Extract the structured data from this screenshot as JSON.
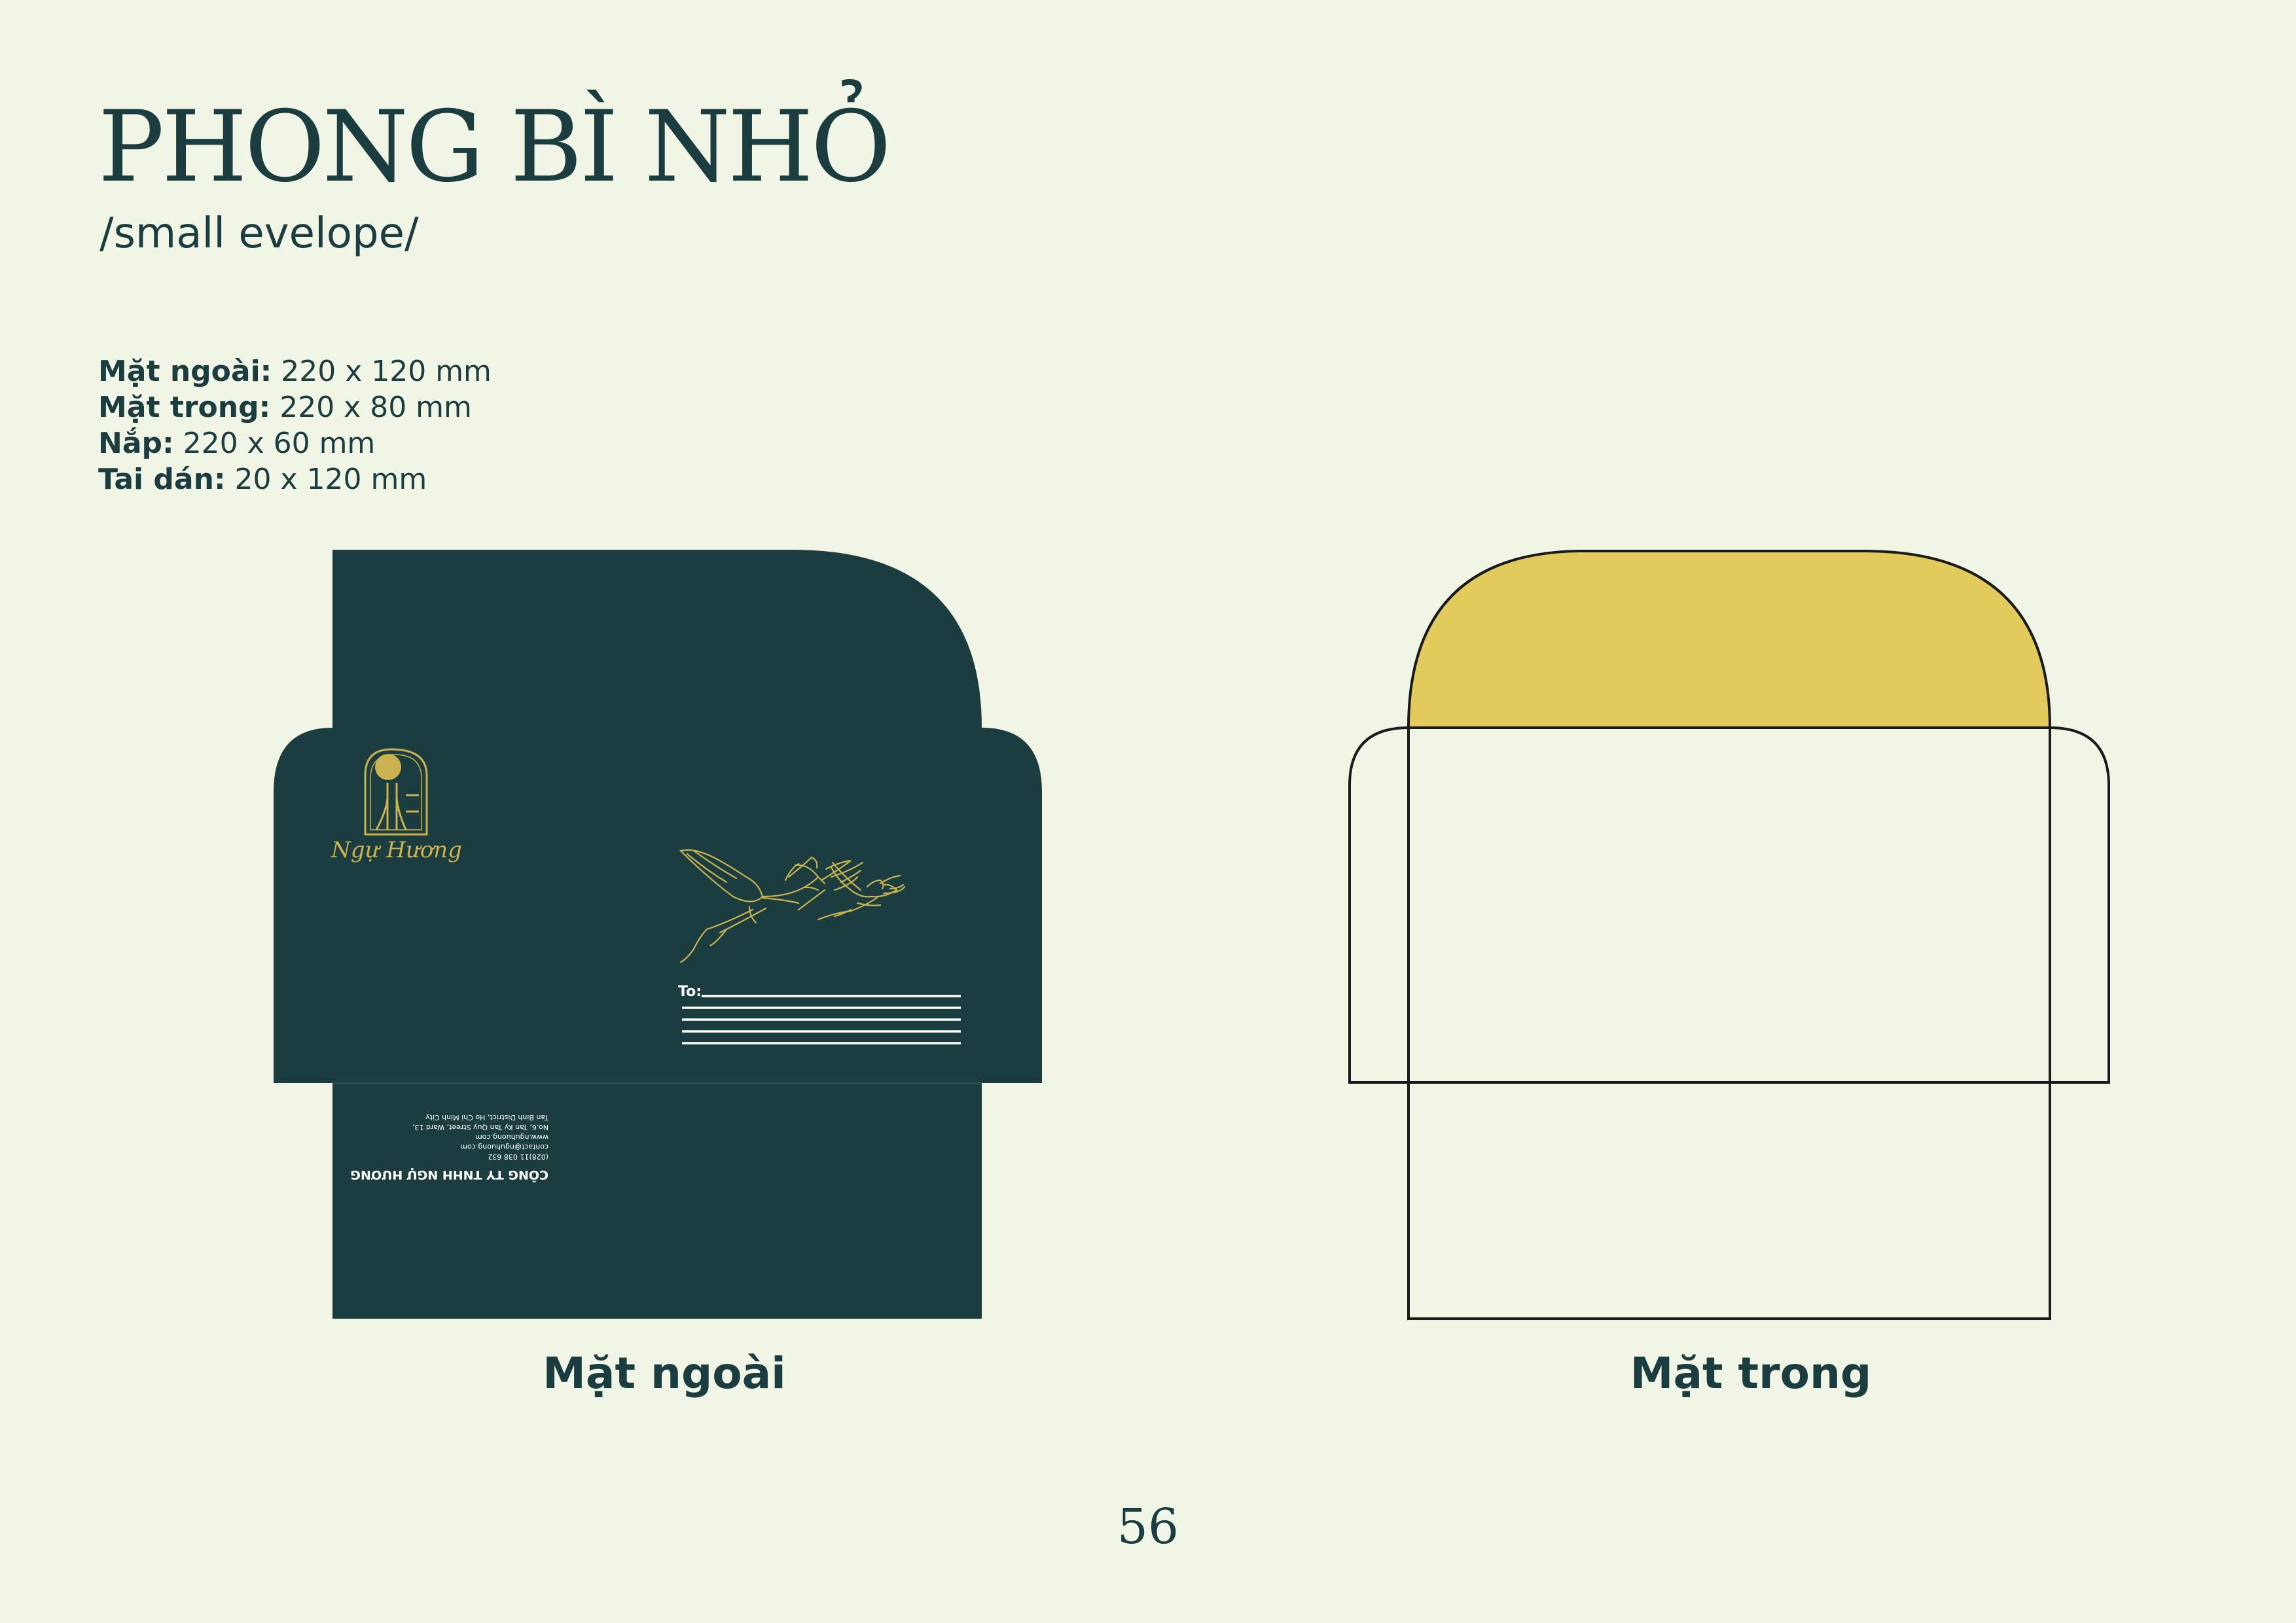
{
  "page": {
    "title": "PHONG BÌ NHỎ",
    "subtitle": "/small evelope/",
    "page_number": "56"
  },
  "specs": [
    {
      "label": "Mặt ngoài:",
      "value": " 220 x 120 mm"
    },
    {
      "label": "Mặt trong:",
      "value": " 220 x 80 mm"
    },
    {
      "label": "Nắp:",
      "value": " 220 x 60 mm"
    },
    {
      "label": "Tai dán:",
      "value": " 20 x 120 mm"
    }
  ],
  "outer": {
    "caption": "Mặt ngoài",
    "brand": "Ngự Hương",
    "to_label": "To:",
    "company": "CÔNG TY TNHH NGỰ HƯƠNG",
    "phone": "(028)11 038 632",
    "email": "contact@nguhuong.com",
    "website": "www.nguhuong.com",
    "address1": "No.6, Tan Ky Tan Quy Street, Ward 13,",
    "address2": "Tan Binh District, Ho Chi Minh City",
    "colors": {
      "primary": "#1c3d40",
      "gold": "#c9b24f"
    }
  },
  "inner": {
    "caption": "Mặt trong",
    "colors": {
      "flap": "#e3ca5c",
      "outline": "#1a1a1a"
    }
  }
}
